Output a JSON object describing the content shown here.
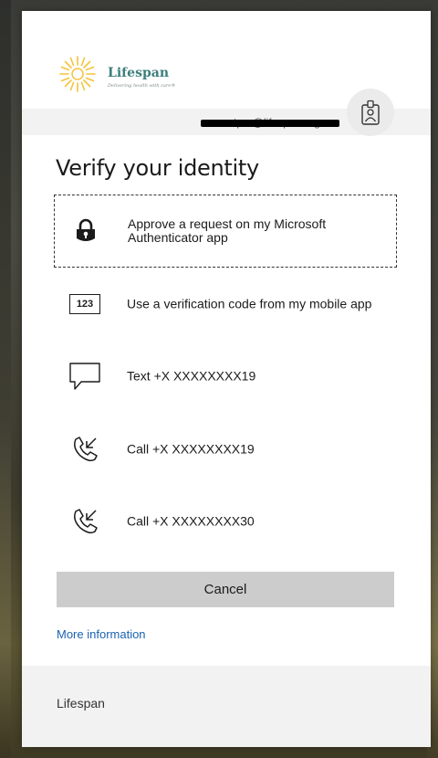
{
  "logo": {
    "name": "Lifespan",
    "tagline": "Delivering health with care®"
  },
  "account": {
    "email": "tpro@lifespan.org"
  },
  "page": {
    "title": "Verify your identity"
  },
  "options": [
    {
      "label": "Approve a request on my Microsoft Authenticator app",
      "icon": "lock-icon"
    },
    {
      "label": "Use a verification code from my mobile app",
      "icon": "code-123-icon",
      "icon_text": "123"
    },
    {
      "label": "Text +X XXXXXXXX19",
      "icon": "speech-bubble-icon"
    },
    {
      "label": "Call +X XXXXXXXX19",
      "icon": "phone-call-icon"
    },
    {
      "label": "Call +X XXXXXXXX30",
      "icon": "phone-call-icon"
    }
  ],
  "actions": {
    "cancel": "Cancel",
    "more_info": "More information"
  },
  "footer": {
    "label": "Lifespan"
  },
  "colors": {
    "link": "#1a62b0",
    "button": "#cccccc",
    "logo_text": "#3c7f7c",
    "sun": "#f5c33b"
  }
}
